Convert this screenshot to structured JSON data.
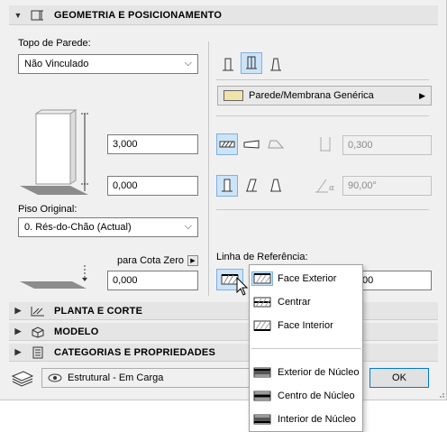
{
  "sections": {
    "geometry": {
      "title": "GEOMETRIA E POSICIONAMENTO",
      "icon": "wall-geometry-icon"
    },
    "plan": {
      "title": "PLANTA E CORTE",
      "icon": "plan-section-icon"
    },
    "model": {
      "title": "MODELO",
      "icon": "model-icon"
    },
    "categories": {
      "title": "CATEGORIAS E PROPRIEDADES",
      "icon": "categories-icon"
    }
  },
  "top_link": {
    "label": "Topo de Parede:",
    "value": "Não Vinculado"
  },
  "height_value": "3,000",
  "bottom_offset_value": "0,000",
  "home_story": {
    "label": "Piso Original:",
    "value": "0. Rés-do-Chão (Actual)"
  },
  "zero_ref": {
    "label": "para Cota Zero",
    "value": "0,000"
  },
  "building_material": {
    "value": "Parede/Membrana Genérica"
  },
  "thickness_value": "0,300",
  "angle_value": "90,00°",
  "reference_line": {
    "label": "Linha de Referência:",
    "value_fragment": "00"
  },
  "popup": {
    "items": [
      {
        "label": "Face Exterior",
        "icon": "outside-face-icon"
      },
      {
        "label": "Centrar",
        "icon": "center-icon"
      },
      {
        "label": "Face Interior",
        "icon": "inside-face-icon"
      },
      {
        "label": "Exterior de Núcleo",
        "icon": "core-outside-icon"
      },
      {
        "label": "Centro de Núcleo",
        "icon": "core-center-icon"
      },
      {
        "label": "Interior de Núcleo",
        "icon": "core-inside-icon"
      }
    ]
  },
  "footer": {
    "layer_value": "Estrutural - Em Carga",
    "ok_label": "OK"
  },
  "colors": {
    "accent": "#0078d7",
    "active_bg": "#cce4f7",
    "section_bg": "#e5e5e5"
  }
}
